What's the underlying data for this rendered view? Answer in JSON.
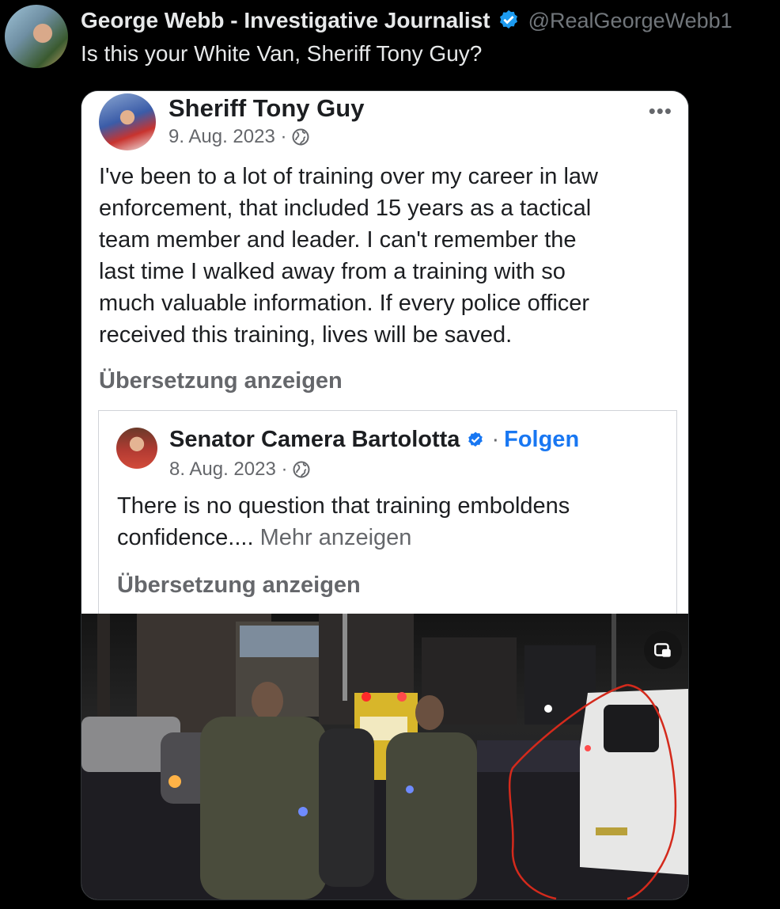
{
  "tweet": {
    "author_name": "George Webb - Investigative Journalist",
    "author_handle": "@RealGeorgeWebb1",
    "verified_icon": "verified-badge-icon",
    "text": "Is this your White Van, Sheriff Tony Guy?",
    "accent_color": "#1d9bf0"
  },
  "embedded_post": {
    "author": "Sheriff Tony Guy",
    "date": "9. Aug. 2023 ·",
    "body_lines": [
      "I've been to a lot of training over my career in law",
      "enforcement, that included 15 years as a tactical",
      "team member and leader. I can't remember the",
      "last time I walked away from a training with so",
      "much valuable information. If every police officer",
      "received this training, lives will be saved."
    ],
    "translate_label": "Übersetzung anzeigen",
    "more_icon": "more-options-icon",
    "shared": {
      "author": "Senator Camera Bartolotta",
      "separator": "·",
      "follow_label": "Folgen",
      "date": "8. Aug. 2023 ·",
      "body_line1": "There is no question that training emboldens",
      "body_line2": "confidence....",
      "see_more": "Mehr anzeigen",
      "translate_label": "Übersetzung anzeigen",
      "follow_color": "#1877f2"
    }
  },
  "video": {
    "pip_icon": "picture-in-picture-icon",
    "annotation_color": "#d42a1c"
  }
}
